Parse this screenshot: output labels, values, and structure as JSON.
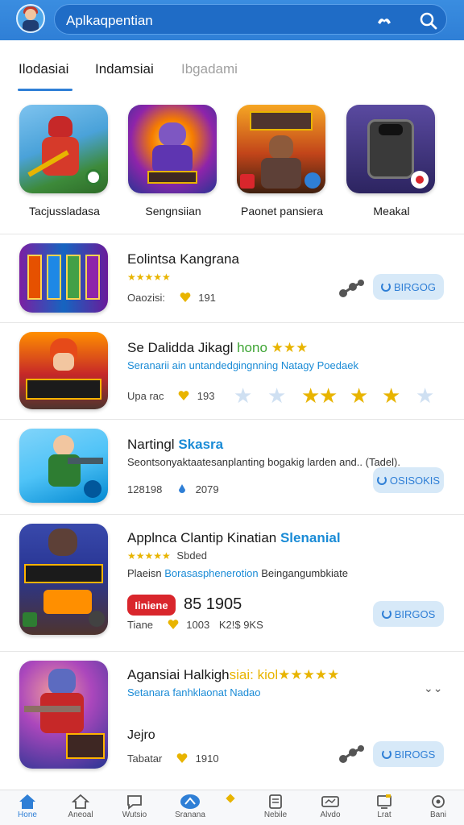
{
  "header": {
    "search_text": "Aplkaqpentian"
  },
  "tabs": [
    {
      "label": "Ilodasiai"
    },
    {
      "label": "Indamsiai"
    },
    {
      "label": "Ibgadami"
    }
  ],
  "featured": [
    {
      "label": "Tacjussladasa"
    },
    {
      "label": "Sengnsiian"
    },
    {
      "label": "Paonet pansiera"
    },
    {
      "label": "Meakal"
    }
  ],
  "list": [
    {
      "title": "Eolintsa Kangrana",
      "stars": "★★★★★",
      "meta_left": "Oaozisi:",
      "meta_count": "191",
      "button": "BIRGOG"
    },
    {
      "title": "Se Dalidda Jikagl",
      "title_green": "hono",
      "title_stars": "★★★",
      "subtitle": "Seranarii ain untandedgingnning Natagy Poedaek",
      "meta_left": "Upa rac",
      "meta_count": "193",
      "rating_stars": [
        "★",
        "★",
        "★",
        "★",
        "★",
        "★"
      ]
    },
    {
      "title": "Nartingl",
      "title_accent": "Skasra",
      "subtitle": "Seontsonyaktaatesanplanting bogakig larden and.. (Tadel).",
      "meta_left": "128198",
      "meta_count": "2079",
      "button": "OSISOKIS"
    },
    {
      "title": "Applnca Clantip Kinatian",
      "title_accent": "Slenanial",
      "stars": "★★★★★",
      "stars_text": "Sbded",
      "subtitle": "Plaeisn",
      "subtitle_accent": "Borasasphenerotion",
      "subtitle_tail": "Beingangumbkiate",
      "badge": "Iiniene",
      "price": "85 1905",
      "meta_left": "Tiane",
      "meta_count": "1003",
      "meta_extra": "K2!$ 9KS",
      "button": "BIRGOS"
    },
    {
      "title": "Agansiai Halkigh",
      "title_gold": "siai: kiol★★★★★",
      "subtitle": "Setanara fanhklaonat Nadao",
      "extra": "Jejro",
      "meta_left": "Tabatar",
      "meta_count": "1910",
      "button": "BIROGS"
    }
  ],
  "bottom_nav": [
    {
      "label": "Hone",
      "icon": "home-icon"
    },
    {
      "label": "Aneoal",
      "icon": "house-outline-icon"
    },
    {
      "label": "Wutsio",
      "icon": "chat-icon"
    },
    {
      "label": "Sranana",
      "icon": "rocket-icon"
    },
    {
      "label": "Nebile",
      "icon": "document-icon"
    },
    {
      "label": "Alvdo",
      "icon": "ticket-icon"
    },
    {
      "label": "Lrat",
      "icon": "monitor-icon"
    },
    {
      "label": "Bani",
      "icon": "gear-icon"
    }
  ],
  "colors": {
    "accent": "#2f7fd6",
    "header": "#3a8de0",
    "star": "#e8b400",
    "badge_red": "#d9262c"
  }
}
